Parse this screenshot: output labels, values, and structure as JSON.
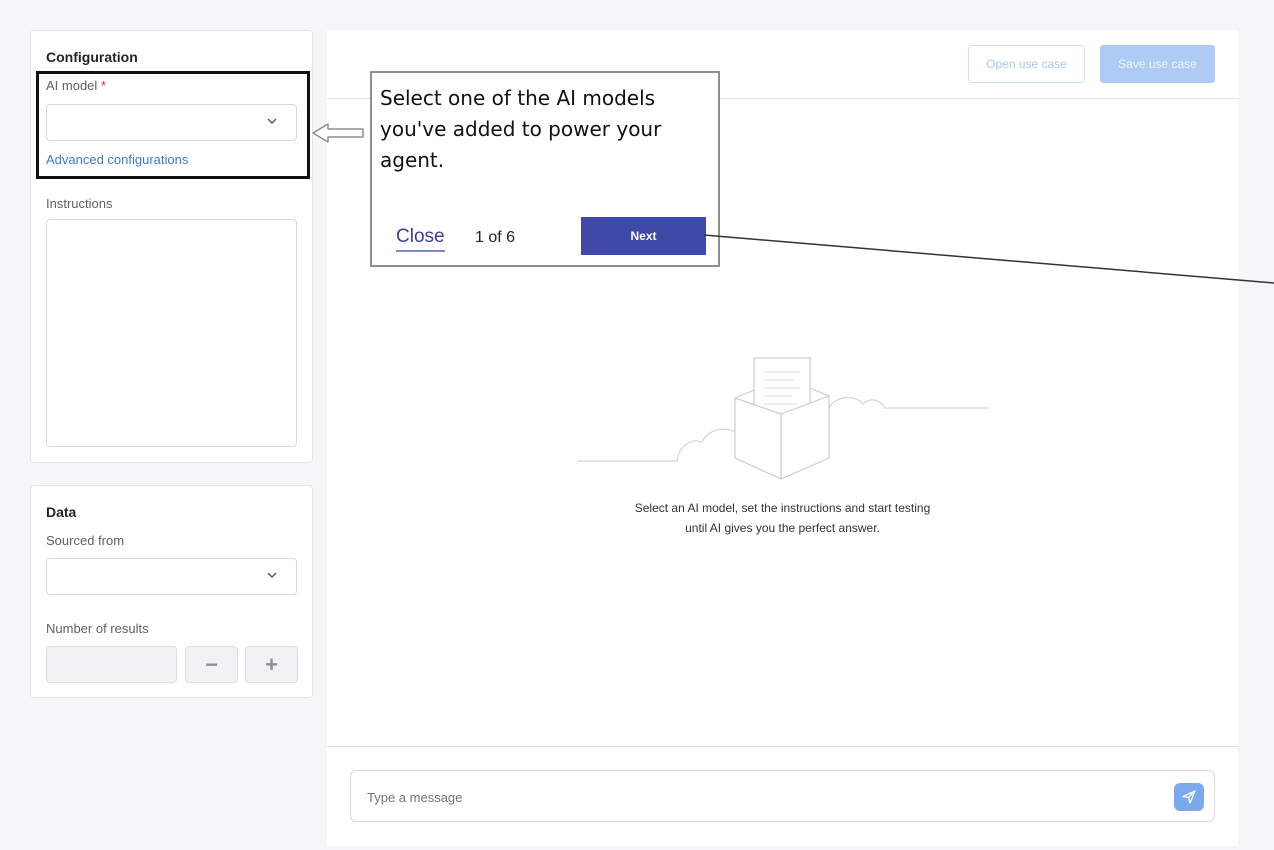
{
  "configuration": {
    "title": "Configuration",
    "ai_model_label": "AI model",
    "required_mark": "*",
    "ai_model_value": "",
    "advanced_link": "Advanced configurations",
    "instructions_label": "Instructions",
    "instructions_value": ""
  },
  "data_panel": {
    "title": "Data",
    "sourced_from_label": "Sourced from",
    "sourced_from_value": "",
    "number_of_results_label": "Number of results",
    "number_of_results_value": "",
    "decrement_label": "−",
    "increment_label": "+"
  },
  "toolbar": {
    "open_use_case": "Open use case",
    "save_use_case": "Save use case"
  },
  "empty_state": {
    "line1": "Select an AI model, set the instructions and start testing",
    "line2": "until AI gives you the perfect answer."
  },
  "message": {
    "placeholder": "Type a message"
  },
  "tour": {
    "text": "Select one of the AI models you've added to power your agent.",
    "close_label": "Close",
    "step_label": "1 of 6",
    "next_label": "Next"
  },
  "icons": {
    "chevron": "chevron-down-icon",
    "send": "send-icon",
    "illustration": "empty-inbox-illustration"
  },
  "colors": {
    "accent": "#3f4aa8",
    "link": "#3a7bd5",
    "disabled_primary": "#aecbf4"
  }
}
